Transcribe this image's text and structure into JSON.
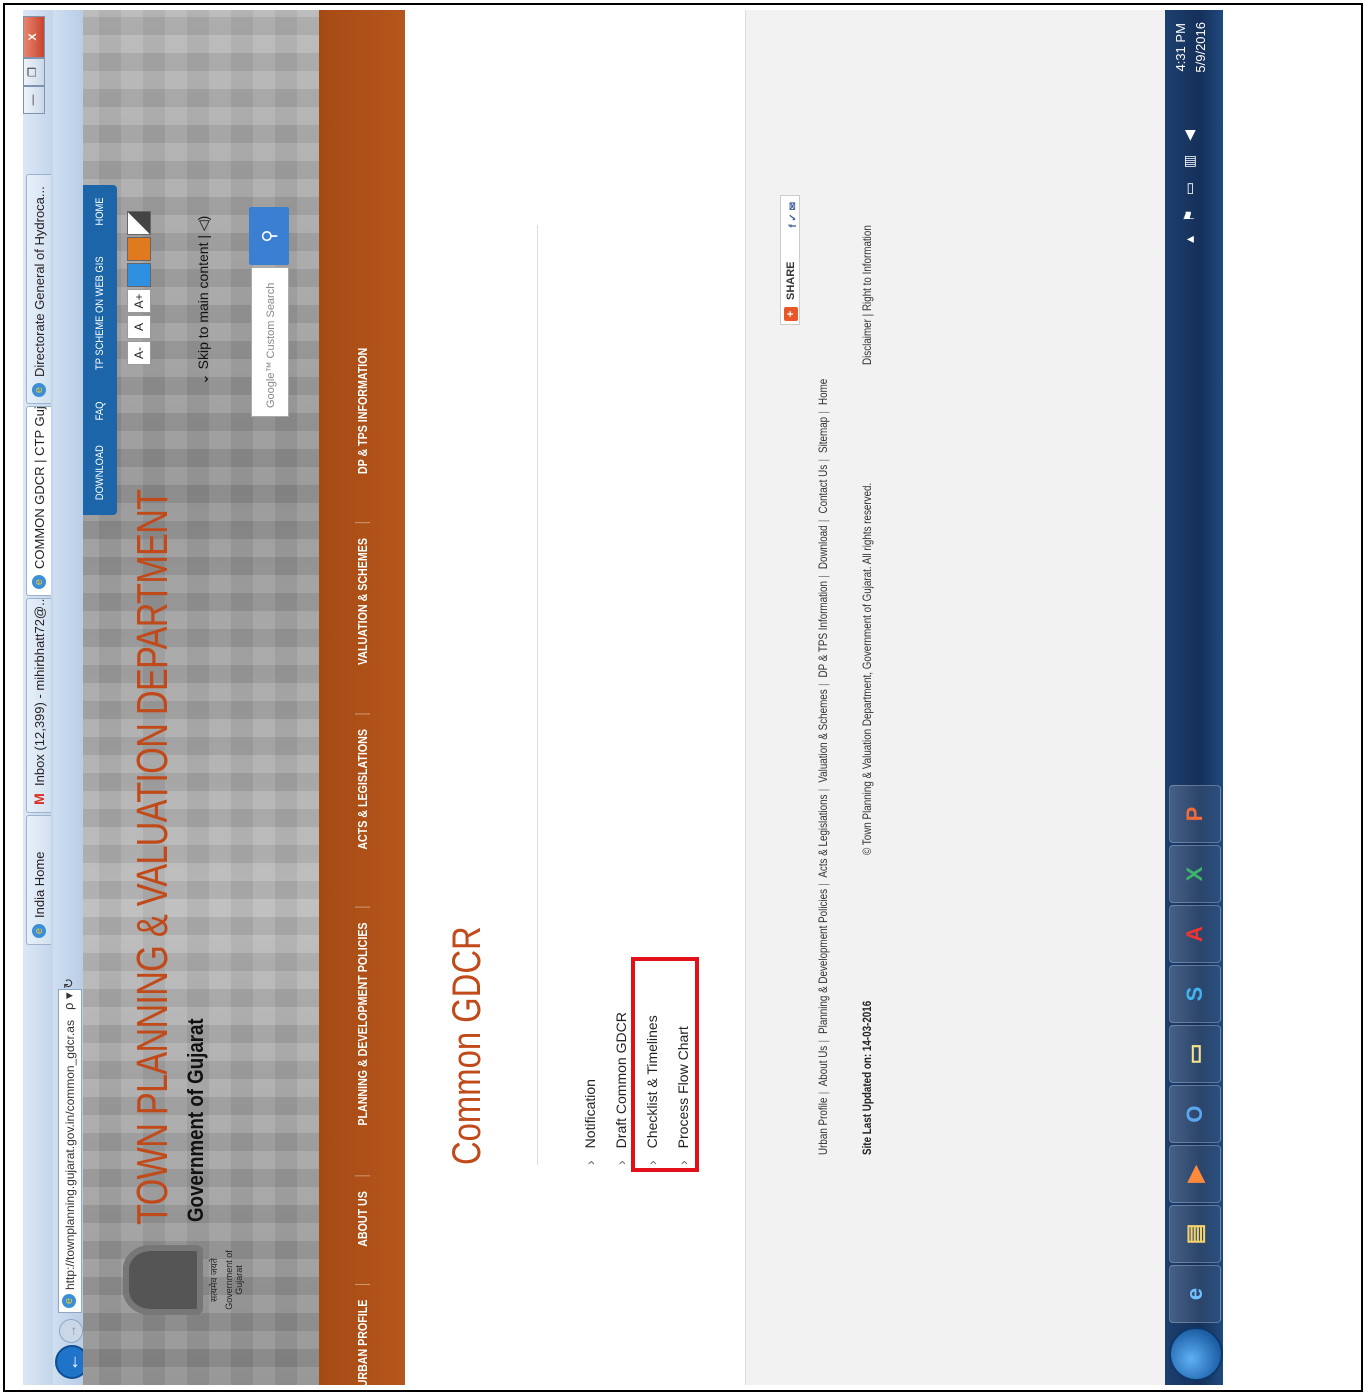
{
  "browser": {
    "url": "http://townplanning.gujarat.gov.in/common_gdcr.as",
    "url_tools": "ρ ▾ ↻",
    "tabs": [
      {
        "label": "India Home",
        "icon": "ie-icon"
      },
      {
        "label": "Inbox (12,399) - mihirbhatt72@...",
        "icon": "gmail-icon"
      },
      {
        "label": "COMMON GDCR | CTP Guj...",
        "icon": "ie-icon",
        "active": true
      },
      {
        "label": "Directorate General of Hydroca...",
        "icon": "ie-icon"
      }
    ],
    "tab_close": "✕",
    "window_buttons": {
      "minimize": "—",
      "restore": "❐",
      "close": "X"
    }
  },
  "header": {
    "emblem_caption": "Government of Gujarat",
    "emblem_caption_hindi": "सत्यमेव जयते",
    "title": "TOWN PLANNING & VALUATION DEPARTMENT",
    "subtitle": "Government of Gujarat",
    "top_links": [
      "DOWNLOAD",
      "FAQ",
      "TP SCHEME ON WEB GIS",
      "HOME"
    ],
    "font_controls": [
      "A-",
      "A",
      "A+"
    ],
    "theme_colors": [
      "#2f8fe0",
      "#e07a1f",
      "#444444"
    ],
    "skip_link": "Skip to main content",
    "search_placeholder": "Google™ Custom Search",
    "search_button": "⚲"
  },
  "menu": [
    "URBAN PROFILE",
    "ABOUT US",
    "PLANNING & DEVELOPMENT POLICIES",
    "ACTS & LEGISLATIONS",
    "VALUATION & SCHEMES",
    "DP & TPS INFORMATION"
  ],
  "content": {
    "heading": "Common GDCR",
    "items": [
      "Notification",
      "Draft Common GDCR",
      "Checklist & Timelines",
      "Process Flow Chart"
    ]
  },
  "footer": {
    "share_label": "SHARE",
    "share_icons": "f ✓ ✉",
    "links": [
      "Urban Profile",
      "About Us",
      "Planning & Development Policies",
      "Acts & Legislations",
      "Valuation & Schemes",
      "DP & TPS Information",
      "Download",
      "Contact Us",
      "Sitemap",
      "Home"
    ],
    "updated": "Site Last Updated on: 14-03-2016",
    "copyright": "© Town Planning & Valuation Department, Government of Gujarat. All rights reserved.",
    "copyright_links": "Disclaimer | Right to Information"
  },
  "taskbar": {
    "apps": [
      {
        "name": "internet-explorer",
        "glyph": "e"
      },
      {
        "name": "file-explorer",
        "glyph": "▤"
      },
      {
        "name": "media-player",
        "glyph": "▶"
      },
      {
        "name": "outlook",
        "glyph": "O"
      },
      {
        "name": "sticky-notes",
        "glyph": "▭"
      },
      {
        "name": "skype",
        "glyph": "S"
      },
      {
        "name": "acrobat",
        "glyph": "A"
      },
      {
        "name": "excel",
        "glyph": "X"
      },
      {
        "name": "powerpoint",
        "glyph": "P"
      }
    ],
    "time": "4:31 PM",
    "date": "5/9/2016"
  }
}
